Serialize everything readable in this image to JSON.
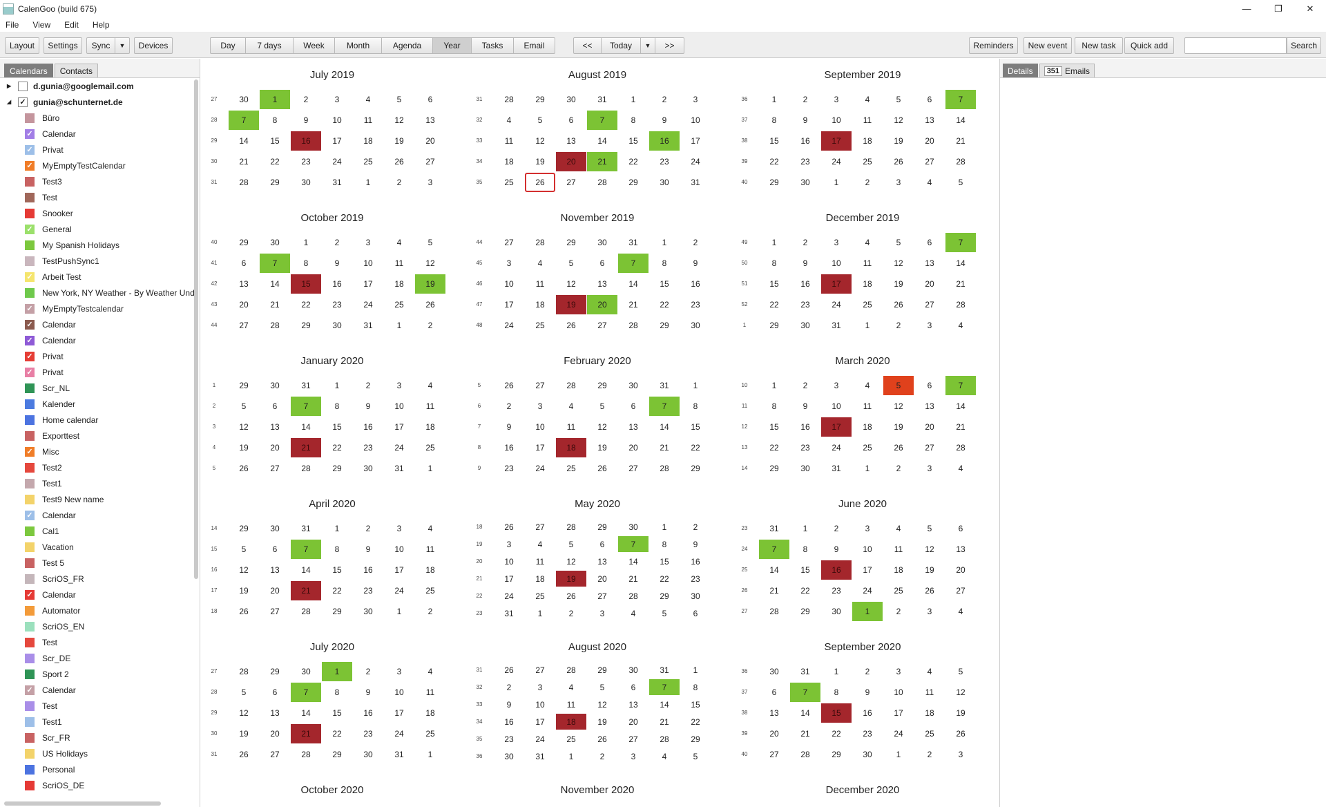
{
  "window": {
    "title": "CalenGoo (build 675)"
  },
  "menu": [
    "File",
    "View",
    "Edit",
    "Help"
  ],
  "toolbar": {
    "left": [
      "Layout",
      "Settings",
      "Sync",
      "Devices"
    ],
    "views": [
      "Day",
      "7 days",
      "Week",
      "Month",
      "Agenda",
      "Year",
      "Tasks",
      "Email"
    ],
    "active_view": "Year",
    "nav": {
      "prev": "<<",
      "today": "Today",
      "next": ">>"
    },
    "right": [
      "Reminders",
      "New event",
      "New task",
      "Quick add"
    ],
    "search_label": "Search"
  },
  "sidebar": {
    "tabs": [
      "Calendars",
      "Contacts"
    ],
    "accounts": [
      {
        "name": "d.gunia@googlemail.com",
        "checked": false,
        "expanded": false
      },
      {
        "name": "gunia@schunternet.de",
        "checked": true,
        "expanded": true
      }
    ],
    "calendars": [
      {
        "name": "Büro",
        "color": "#c4959d",
        "checked": false
      },
      {
        "name": "Calendar",
        "color": "#a27ee6",
        "checked": true
      },
      {
        "name": "Privat",
        "color": "#9dbfe8",
        "checked": true
      },
      {
        "name": "MyEmptyTestCalendar",
        "color": "#f07d28",
        "checked": true
      },
      {
        "name": "Test3",
        "color": "#c86262",
        "checked": false
      },
      {
        "name": "Test",
        "color": "#a0675a",
        "checked": false
      },
      {
        "name": "Snooker",
        "color": "#e53a35",
        "checked": false
      },
      {
        "name": "General",
        "color": "#9be06b",
        "checked": true
      },
      {
        "name": "My Spanish Holidays",
        "color": "#7cc83e",
        "checked": false
      },
      {
        "name": "TestPushSync1",
        "color": "#c9b6bd",
        "checked": false
      },
      {
        "name": "Arbeit Test",
        "color": "#f5e56e",
        "checked": true
      },
      {
        "name": "New York, NY Weather - By Weather Und",
        "color": "#6fc94c",
        "checked": false
      },
      {
        "name": "MyEmptyTestcalendar",
        "color": "#c4a0a6",
        "checked": true
      },
      {
        "name": "Calendar",
        "color": "#8b5a4e",
        "checked": true
      },
      {
        "name": "Calendar",
        "color": "#8e5ad6",
        "checked": true
      },
      {
        "name": "Privat",
        "color": "#e53d35",
        "checked": true
      },
      {
        "name": "Privat",
        "color": "#e87fa5",
        "checked": true
      },
      {
        "name": "Scr_NL",
        "color": "#2f9456",
        "checked": false
      },
      {
        "name": "Kalender",
        "color": "#4c7be0",
        "checked": false
      },
      {
        "name": "Home calendar",
        "color": "#4c73e0",
        "checked": false
      },
      {
        "name": "Exporttest",
        "color": "#c86262",
        "checked": false
      },
      {
        "name": "Misc",
        "color": "#f07d28",
        "checked": true
      },
      {
        "name": "Test2",
        "color": "#e5483d",
        "checked": false
      },
      {
        "name": "Test1",
        "color": "#c4a8ad",
        "checked": false
      },
      {
        "name": "Test9 New name",
        "color": "#f3d36a",
        "checked": false
      },
      {
        "name": "Calendar",
        "color": "#9dbfe8",
        "checked": true
      },
      {
        "name": "Cal1",
        "color": "#7cc83e",
        "checked": false
      },
      {
        "name": "Vacation",
        "color": "#f3d36a",
        "checked": false
      },
      {
        "name": "Test 5",
        "color": "#c86262",
        "checked": false
      },
      {
        "name": "ScriOS_FR",
        "color": "#c4b6ba",
        "checked": false
      },
      {
        "name": "Calendar",
        "color": "#e53a35",
        "checked": true
      },
      {
        "name": "Automator",
        "color": "#f39b3a",
        "checked": false
      },
      {
        "name": "ScriOS_EN",
        "color": "#9be0bd",
        "checked": false
      },
      {
        "name": "Test",
        "color": "#e5483d",
        "checked": false
      },
      {
        "name": "Scr_DE",
        "color": "#a98ee8",
        "checked": false
      },
      {
        "name": "Sport 2",
        "color": "#2f9456",
        "checked": false
      },
      {
        "name": "Calendar",
        "color": "#c4a0a6",
        "checked": true
      },
      {
        "name": "Test",
        "color": "#a98ee8",
        "checked": false
      },
      {
        "name": "Test1",
        "color": "#9dbfe8",
        "checked": false
      },
      {
        "name": "Scr_FR",
        "color": "#c86262",
        "checked": false
      },
      {
        "name": "US Holidays",
        "color": "#f3d36a",
        "checked": false
      },
      {
        "name": "Personal",
        "color": "#4c73e0",
        "checked": false
      },
      {
        "name": "ScriOS_DE",
        "color": "#e53a35",
        "checked": false
      }
    ]
  },
  "months": [
    {
      "title": "July 2019",
      "weeks": [
        "27",
        "28",
        "29",
        "30",
        "31"
      ],
      "days": [
        [
          30,
          1,
          2,
          3,
          4,
          5,
          6
        ],
        [
          7,
          8,
          9,
          10,
          11,
          12,
          13
        ],
        [
          14,
          15,
          16,
          17,
          18,
          19,
          20
        ],
        [
          21,
          22,
          23,
          24,
          25,
          26,
          27
        ],
        [
          28,
          29,
          30,
          31,
          1,
          2,
          3
        ]
      ],
      "marks": {
        "0-1": "g",
        "1-0": "g",
        "2-2": "r"
      }
    },
    {
      "title": "August 2019",
      "weeks": [
        "31",
        "32",
        "33",
        "34",
        "35"
      ],
      "days": [
        [
          28,
          29,
          30,
          31,
          1,
          2,
          3
        ],
        [
          4,
          5,
          6,
          7,
          8,
          9,
          10
        ],
        [
          11,
          12,
          13,
          14,
          15,
          16,
          17
        ],
        [
          18,
          19,
          20,
          21,
          22,
          23,
          24
        ],
        [
          25,
          26,
          27,
          28,
          29,
          30,
          31
        ]
      ],
      "marks": {
        "1-3": "g",
        "2-5": "g",
        "3-2": "r",
        "3-3": "g",
        "4-1": "t"
      }
    },
    {
      "title": "September 2019",
      "weeks": [
        "36",
        "37",
        "38",
        "39",
        "40"
      ],
      "days": [
        [
          1,
          2,
          3,
          4,
          5,
          6,
          7
        ],
        [
          8,
          9,
          10,
          11,
          12,
          13,
          14
        ],
        [
          15,
          16,
          17,
          18,
          19,
          20,
          21
        ],
        [
          22,
          23,
          24,
          25,
          26,
          27,
          28
        ],
        [
          29,
          30,
          1,
          2,
          3,
          4,
          5
        ]
      ],
      "marks": {
        "0-6": "g",
        "2-2": "r"
      }
    },
    {
      "title": "October 2019",
      "weeks": [
        "40",
        "41",
        "42",
        "43",
        "44"
      ],
      "days": [
        [
          29,
          30,
          1,
          2,
          3,
          4,
          5
        ],
        [
          6,
          7,
          8,
          9,
          10,
          11,
          12
        ],
        [
          13,
          14,
          15,
          16,
          17,
          18,
          19
        ],
        [
          20,
          21,
          22,
          23,
          24,
          25,
          26
        ],
        [
          27,
          28,
          29,
          30,
          31,
          1,
          2
        ]
      ],
      "marks": {
        "1-1": "g",
        "2-2": "r",
        "2-6": "g"
      }
    },
    {
      "title": "November 2019",
      "weeks": [
        "44",
        "45",
        "46",
        "47",
        "48"
      ],
      "days": [
        [
          27,
          28,
          29,
          30,
          31,
          1,
          2
        ],
        [
          3,
          4,
          5,
          6,
          7,
          8,
          9
        ],
        [
          10,
          11,
          12,
          13,
          14,
          15,
          16
        ],
        [
          17,
          18,
          19,
          20,
          21,
          22,
          23
        ],
        [
          24,
          25,
          26,
          27,
          28,
          29,
          30
        ]
      ],
      "marks": {
        "1-4": "g",
        "3-2": "r",
        "3-3": "g"
      }
    },
    {
      "title": "December 2019",
      "weeks": [
        "49",
        "50",
        "51",
        "52",
        "1"
      ],
      "days": [
        [
          1,
          2,
          3,
          4,
          5,
          6,
          7
        ],
        [
          8,
          9,
          10,
          11,
          12,
          13,
          14
        ],
        [
          15,
          16,
          17,
          18,
          19,
          20,
          21
        ],
        [
          22,
          23,
          24,
          25,
          26,
          27,
          28
        ],
        [
          29,
          30,
          31,
          1,
          2,
          3,
          4
        ]
      ],
      "marks": {
        "0-6": "g",
        "2-2": "r"
      }
    },
    {
      "title": "January 2020",
      "weeks": [
        "1",
        "2",
        "3",
        "4",
        "5"
      ],
      "days": [
        [
          29,
          30,
          31,
          1,
          2,
          3,
          4
        ],
        [
          5,
          6,
          7,
          8,
          9,
          10,
          11
        ],
        [
          12,
          13,
          14,
          15,
          16,
          17,
          18
        ],
        [
          19,
          20,
          21,
          22,
          23,
          24,
          25
        ],
        [
          26,
          27,
          28,
          29,
          30,
          31,
          1
        ]
      ],
      "marks": {
        "1-2": "g",
        "3-2": "r"
      }
    },
    {
      "title": "February 2020",
      "weeks": [
        "5",
        "6",
        "7",
        "8",
        "9"
      ],
      "days": [
        [
          26,
          27,
          28,
          29,
          30,
          31,
          1
        ],
        [
          2,
          3,
          4,
          5,
          6,
          7,
          8
        ],
        [
          9,
          10,
          11,
          12,
          13,
          14,
          15
        ],
        [
          16,
          17,
          18,
          19,
          20,
          21,
          22
        ],
        [
          23,
          24,
          25,
          26,
          27,
          28,
          29
        ]
      ],
      "marks": {
        "1-5": "g",
        "3-2": "r"
      }
    },
    {
      "title": "March 2020",
      "weeks": [
        "10",
        "11",
        "12",
        "13",
        "14"
      ],
      "days": [
        [
          1,
          2,
          3,
          4,
          5,
          6,
          7
        ],
        [
          8,
          9,
          10,
          11,
          12,
          13,
          14
        ],
        [
          15,
          16,
          17,
          18,
          19,
          20,
          21
        ],
        [
          22,
          23,
          24,
          25,
          26,
          27,
          28
        ],
        [
          29,
          30,
          31,
          1,
          2,
          3,
          4
        ]
      ],
      "marks": {
        "0-4": "o",
        "0-6": "g",
        "2-2": "r"
      }
    },
    {
      "title": "April 2020",
      "weeks": [
        "14",
        "15",
        "16",
        "17",
        "18"
      ],
      "days": [
        [
          29,
          30,
          31,
          1,
          2,
          3,
          4
        ],
        [
          5,
          6,
          7,
          8,
          9,
          10,
          11
        ],
        [
          12,
          13,
          14,
          15,
          16,
          17,
          18
        ],
        [
          19,
          20,
          21,
          22,
          23,
          24,
          25
        ],
        [
          26,
          27,
          28,
          29,
          30,
          1,
          2
        ]
      ],
      "marks": {
        "1-2": "g",
        "3-2": "r"
      }
    },
    {
      "title": "May 2020",
      "weeks": [
        "18",
        "19",
        "20",
        "21",
        "22",
        "23"
      ],
      "days": [
        [
          26,
          27,
          28,
          29,
          30,
          1,
          2
        ],
        [
          3,
          4,
          5,
          6,
          7,
          8,
          9
        ],
        [
          10,
          11,
          12,
          13,
          14,
          15,
          16
        ],
        [
          17,
          18,
          19,
          20,
          21,
          22,
          23
        ],
        [
          24,
          25,
          26,
          27,
          28,
          29,
          30
        ],
        [
          31,
          1,
          2,
          3,
          4,
          5,
          6
        ]
      ],
      "marks": {
        "1-4": "g",
        "3-2": "r"
      }
    },
    {
      "title": "June 2020",
      "weeks": [
        "23",
        "24",
        "25",
        "26",
        "27"
      ],
      "days": [
        [
          31,
          1,
          2,
          3,
          4,
          5,
          6
        ],
        [
          7,
          8,
          9,
          10,
          11,
          12,
          13
        ],
        [
          14,
          15,
          16,
          17,
          18,
          19,
          20
        ],
        [
          21,
          22,
          23,
          24,
          25,
          26,
          27
        ],
        [
          28,
          29,
          30,
          1,
          2,
          3,
          4
        ]
      ],
      "marks": {
        "1-0": "g",
        "2-2": "r",
        "4-3": "g"
      }
    },
    {
      "title": "July 2020",
      "weeks": [
        "27",
        "28",
        "29",
        "30",
        "31"
      ],
      "days": [
        [
          28,
          29,
          30,
          1,
          2,
          3,
          4
        ],
        [
          5,
          6,
          7,
          8,
          9,
          10,
          11
        ],
        [
          12,
          13,
          14,
          15,
          16,
          17,
          18
        ],
        [
          19,
          20,
          21,
          22,
          23,
          24,
          25
        ],
        [
          26,
          27,
          28,
          29,
          30,
          31,
          1
        ]
      ],
      "marks": {
        "0-3": "g",
        "1-2": "g",
        "3-2": "r"
      }
    },
    {
      "title": "August 2020",
      "weeks": [
        "31",
        "32",
        "33",
        "34",
        "35",
        "36"
      ],
      "days": [
        [
          26,
          27,
          28,
          29,
          30,
          31,
          1
        ],
        [
          2,
          3,
          4,
          5,
          6,
          7,
          8
        ],
        [
          9,
          10,
          11,
          12,
          13,
          14,
          15
        ],
        [
          16,
          17,
          18,
          19,
          20,
          21,
          22
        ],
        [
          23,
          24,
          25,
          26,
          27,
          28,
          29
        ],
        [
          30,
          31,
          1,
          2,
          3,
          4,
          5
        ]
      ],
      "marks": {
        "1-5": "g",
        "3-2": "r"
      }
    },
    {
      "title": "September 2020",
      "weeks": [
        "36",
        "37",
        "38",
        "39",
        "40"
      ],
      "days": [
        [
          30,
          31,
          1,
          2,
          3,
          4,
          5
        ],
        [
          6,
          7,
          8,
          9,
          10,
          11,
          12
        ],
        [
          13,
          14,
          15,
          16,
          17,
          18,
          19
        ],
        [
          20,
          21,
          22,
          23,
          24,
          25,
          26
        ],
        [
          27,
          28,
          29,
          30,
          1,
          2,
          3
        ]
      ],
      "marks": {
        "1-1": "g",
        "2-2": "r"
      }
    },
    {
      "title": "October 2020",
      "weeks": [],
      "days": [],
      "marks": {}
    },
    {
      "title": "November 2020",
      "weeks": [],
      "days": [],
      "marks": {}
    },
    {
      "title": "December 2020",
      "weeks": [],
      "days": [],
      "marks": {}
    }
  ],
  "right_panel": {
    "tab_details": "Details",
    "email_count": "351",
    "tab_emails": "Emails"
  }
}
